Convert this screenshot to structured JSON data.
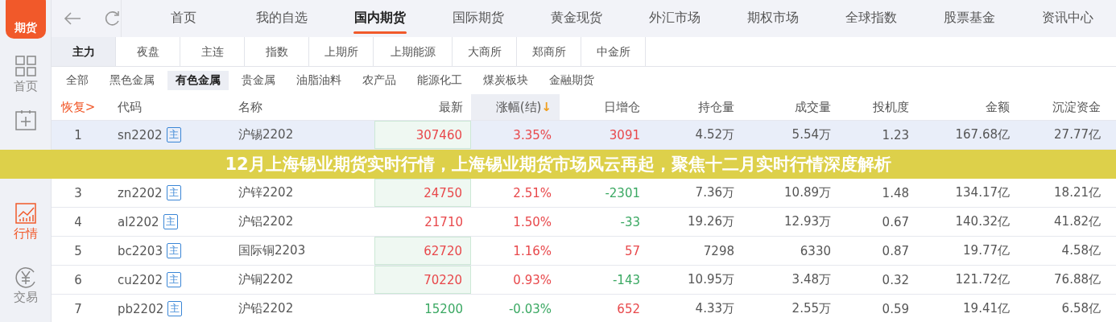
{
  "sidebar": {
    "logo": "期货",
    "items": [
      {
        "label": "首页",
        "selected": false
      },
      {
        "selected": false
      },
      {
        "label": "行情",
        "selected": true
      },
      {
        "label": "交易",
        "selected": false
      }
    ]
  },
  "nav": {
    "tabs": [
      {
        "label": "首页",
        "selected": false
      },
      {
        "label": "我的自选",
        "selected": false
      },
      {
        "label": "国内期货",
        "selected": true
      },
      {
        "label": "国际期货",
        "selected": false
      },
      {
        "label": "黄金现货",
        "selected": false
      },
      {
        "label": "外汇市场",
        "selected": false
      },
      {
        "label": "期权市场",
        "selected": false
      },
      {
        "label": "全球指数",
        "selected": false
      },
      {
        "label": "股票基金",
        "selected": false
      },
      {
        "label": "资讯中心",
        "selected": false
      }
    ]
  },
  "exchange_tabs": [
    {
      "label": "主力",
      "selected": true
    },
    {
      "label": "夜盘",
      "selected": false
    },
    {
      "label": "主连",
      "selected": false
    },
    {
      "label": "指数",
      "selected": false
    },
    {
      "label": "上期所",
      "selected": false
    },
    {
      "label": "上期能源",
      "selected": false
    },
    {
      "label": "大商所",
      "selected": false
    },
    {
      "label": "郑商所",
      "selected": false
    },
    {
      "label": "中金所",
      "selected": false
    }
  ],
  "category_tabs": [
    {
      "label": "全部",
      "selected": false
    },
    {
      "label": "黑色金属",
      "selected": false
    },
    {
      "label": "有色金属",
      "selected": true
    },
    {
      "label": "贵金属",
      "selected": false
    },
    {
      "label": "油脂油料",
      "selected": false
    },
    {
      "label": "农产品",
      "selected": false
    },
    {
      "label": "能源化工",
      "selected": false
    },
    {
      "label": "煤炭板块",
      "selected": false
    },
    {
      "label": "金融期货",
      "selected": false
    }
  ],
  "table": {
    "reset_link": "恢复>",
    "columns": [
      {
        "label": "代码",
        "sorted": false
      },
      {
        "label": "名称",
        "sorted": false
      },
      {
        "label": "最新",
        "sorted": false
      },
      {
        "label": "涨幅(结)",
        "sorted": true,
        "sort_arrow": "↓"
      },
      {
        "label": "日增仓",
        "sorted": false
      },
      {
        "label": "持仓量",
        "sorted": false
      },
      {
        "label": "成交量",
        "sorted": false
      },
      {
        "label": "投机度",
        "sorted": false
      },
      {
        "label": "金额",
        "sorted": false
      },
      {
        "label": "沉淀资金",
        "sorted": false
      }
    ],
    "rows": [
      {
        "index": "1",
        "code": "sn2202",
        "badge": "主",
        "name": "沪锡2202",
        "price": {
          "last": "307460",
          "change": "3.35%",
          "color": "#e8484b"
        },
        "flash": true,
        "oi_change": {
          "text": "3091",
          "color": "#e8484b"
        },
        "open_interest": "4.52万",
        "volume": "5.54万",
        "speculation": "1.23",
        "amount": "167.68亿",
        "capital": "27.77亿",
        "selected": true
      },
      {
        "index": "3",
        "code": "zn2202",
        "badge": "主",
        "name": "沪锌2202",
        "price": {
          "last": "24750",
          "change": "2.51%",
          "color": "#e8484b"
        },
        "flash": true,
        "oi_change": {
          "text": "-2301",
          "color": "#3aa862"
        },
        "open_interest": "7.36万",
        "volume": "10.89万",
        "speculation": "1.48",
        "amount": "134.17亿",
        "capital": "18.21亿",
        "selected": false
      },
      {
        "index": "4",
        "code": "al2202",
        "badge": "主",
        "name": "沪铝2202",
        "price": {
          "last": "21710",
          "change": "1.50%",
          "color": "#e8484b"
        },
        "flash": false,
        "oi_change": {
          "text": "-33",
          "color": "#3aa862"
        },
        "open_interest": "19.26万",
        "volume": "12.93万",
        "speculation": "0.67",
        "amount": "140.32亿",
        "capital": "41.82亿",
        "selected": false
      },
      {
        "index": "5",
        "code": "bc2203",
        "badge": "主",
        "name": "国际铜2203",
        "price": {
          "last": "62720",
          "change": "1.16%",
          "color": "#e8484b"
        },
        "flash": true,
        "oi_change": {
          "text": "57",
          "color": "#e8484b"
        },
        "open_interest": "7298",
        "volume": "6330",
        "speculation": "0.87",
        "amount": "19.77亿",
        "capital": "4.58亿",
        "selected": false
      },
      {
        "index": "6",
        "code": "cu2202",
        "badge": "主",
        "name": "沪铜2202",
        "price": {
          "last": "70220",
          "change": "0.93%",
          "color": "#e8484b"
        },
        "flash": true,
        "oi_change": {
          "text": "-143",
          "color": "#3aa862"
        },
        "open_interest": "10.95万",
        "volume": "3.48万",
        "speculation": "0.32",
        "amount": "121.72亿",
        "capital": "76.88亿",
        "selected": false
      },
      {
        "index": "7",
        "code": "pb2202",
        "badge": "主",
        "name": "沪铅2202",
        "price": {
          "last": "15200",
          "change": "-0.03%",
          "color": "#3aa862"
        },
        "flash": false,
        "oi_change": {
          "text": "652",
          "color": "#e8484b"
        },
        "open_interest": "4.33万",
        "volume": "2.55万",
        "speculation": "0.59",
        "amount": "19.41亿",
        "capital": "6.58亿",
        "selected": false
      }
    ]
  },
  "banner": {
    "title": "12月上海锡业期货实时行情，上海锡业期货市场风云再起，聚焦十二月实时行情深度解析"
  }
}
